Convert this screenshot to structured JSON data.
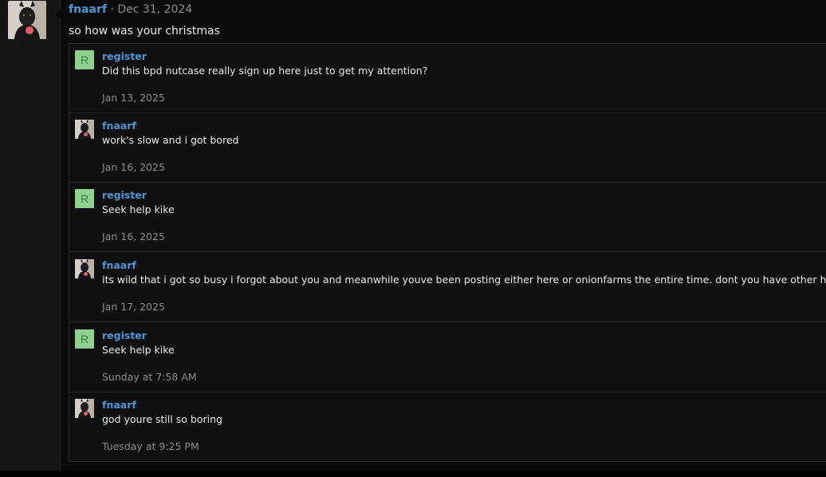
{
  "post": {
    "author": "fnaarf",
    "separator": "·",
    "date": "Dec 31, 2024",
    "body": "so how was your christmas"
  },
  "comments": [
    {
      "author": "register",
      "avatar_letter": "R",
      "text": "Did this bpd nutcase really sign up here just to get my attention?",
      "date": "Jan 13, 2025"
    },
    {
      "author": "fnaarf",
      "text": "work's slow and i got bored",
      "date": "Jan 16, 2025"
    },
    {
      "author": "register",
      "avatar_letter": "R",
      "text": "Seek help kike",
      "date": "Jan 16, 2025"
    },
    {
      "author": "fnaarf",
      "text": "its wild that i got so busy i forgot about you and meanwhile youve been posting either here or onionfarms the entire time. dont you have other hobbies?",
      "date": "Jan 17, 2025"
    },
    {
      "author": "register",
      "avatar_letter": "R",
      "text": "Seek help kike",
      "date": "Sunday at 7:58 AM"
    },
    {
      "author": "fnaarf",
      "text": "god youre still so boring",
      "date": "Tuesday at 9:25 PM"
    }
  ],
  "colors": {
    "username": "#4b97d6",
    "date": "#8b8b8b",
    "letter_avatar_bg": "#8fcf8f",
    "letter_avatar_fg": "#3b7a3b",
    "background": "#0b0b0b"
  },
  "icons": {
    "user_avatar": "doberman-dog-avatar"
  }
}
